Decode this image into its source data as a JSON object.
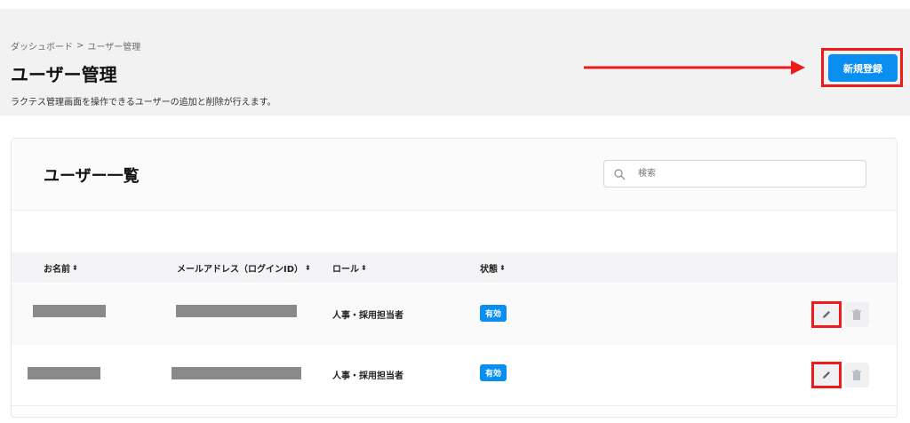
{
  "breadcrumb": {
    "home": "ダッシュボード",
    "separator": ">",
    "current": "ユーザー管理"
  },
  "header": {
    "title": "ユーザー管理",
    "description": "ラクテス管理画面を操作できるユーザーの追加と削除が行えます。",
    "register_label": "新規登録"
  },
  "list": {
    "title": "ユーザー一覧",
    "search_placeholder": "検索",
    "columns": [
      {
        "label": "お名前",
        "sort_icon": "⬍"
      },
      {
        "label": "メールアドレス（ログインID）",
        "sort_icon": "⬍"
      },
      {
        "label": "ロール",
        "sort_icon": "⬍"
      },
      {
        "label": "状態",
        "sort_icon": "⬍"
      }
    ],
    "rows": [
      {
        "role": "人事・採用担当者",
        "status": "有効"
      },
      {
        "role": "人事・採用担当者",
        "status": "有効"
      }
    ]
  },
  "colors": {
    "accent": "#0a8ef0",
    "highlight": "#ee1b1b",
    "header_bg": "#f2f2f3"
  },
  "icons": {
    "search": "search-icon",
    "edit": "pencil-icon",
    "delete": "trash-icon",
    "sort": "sort-icon"
  }
}
